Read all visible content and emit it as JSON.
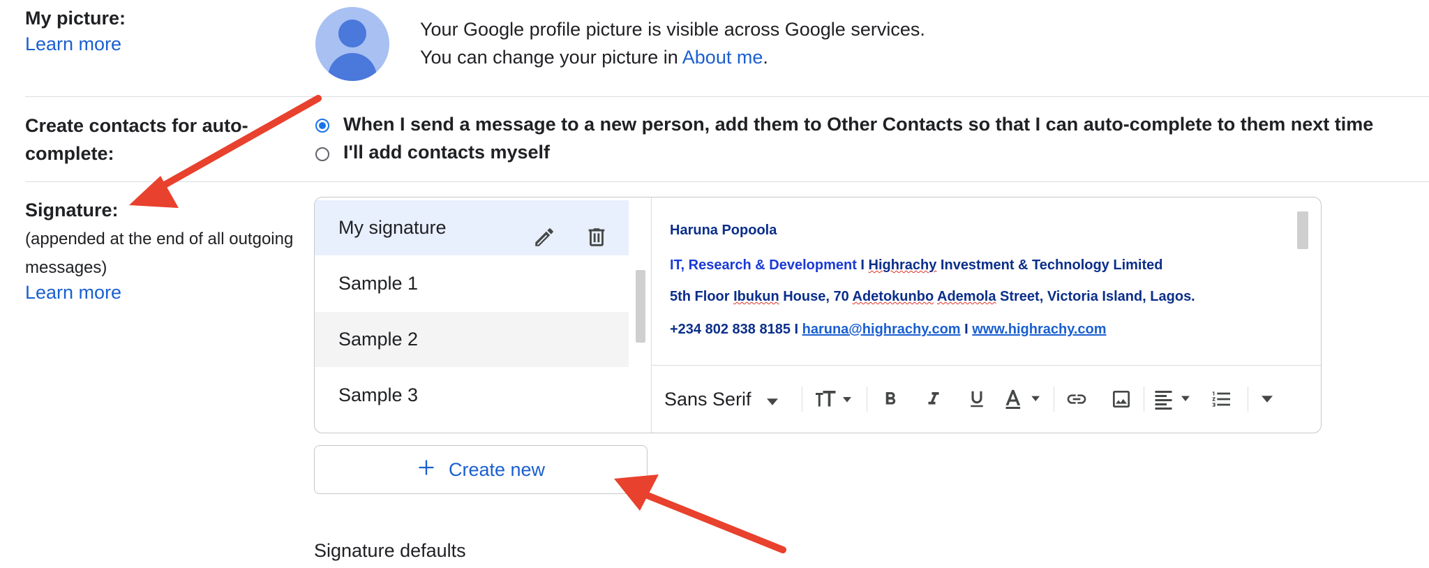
{
  "picture": {
    "label": "My picture:",
    "learn_more": "Learn more",
    "line1": "Your Google profile picture is visible across Google services.",
    "line2_prefix": "You can change your picture in ",
    "line2_link": "About me",
    "line2_suffix": "."
  },
  "contacts": {
    "label_line1": "Create contacts for auto-",
    "label_line2": "complete:",
    "options": [
      {
        "label": "When I send a message to a new person, add them to Other Contacts so that I can auto-complete to them next time",
        "selected": true
      },
      {
        "label": "I'll add contacts myself",
        "selected": false
      }
    ]
  },
  "signature": {
    "label": "Signature:",
    "desc_line1": "(appended at the end of all outgoing",
    "desc_line2": "messages)",
    "learn_more": "Learn more",
    "list": [
      "My signature",
      "Sample 1",
      "Sample 2",
      "Sample 3"
    ],
    "editor": {
      "name": "Haruna Popoola",
      "dept": "IT, Research & Development",
      "sep": " I ",
      "company_word1": "Highrachy",
      "company_rest": " Investment & Technology Limited",
      "addr_a": "5th Floor ",
      "addr_b": "Ibukun",
      "addr_c": " House, 70 ",
      "addr_d": "Adetokunbo",
      "addr_e": " ",
      "addr_f": "Ademola",
      "addr_g": " Street, Victoria Island, Lagos.",
      "phone": "+234 802 838 8185 I ",
      "email": "haruna@highrachy.com",
      "sep2": " I ",
      "website": "www.highrachy.com"
    },
    "toolbar": {
      "font": "Sans Serif"
    },
    "create_new": "Create new",
    "defaults_heading": "Signature defaults"
  },
  "colors": {
    "accent": "#1a73e8",
    "link": "#1a5fd0",
    "arrow": "#e8412d",
    "selected_row": "#e8effd"
  }
}
